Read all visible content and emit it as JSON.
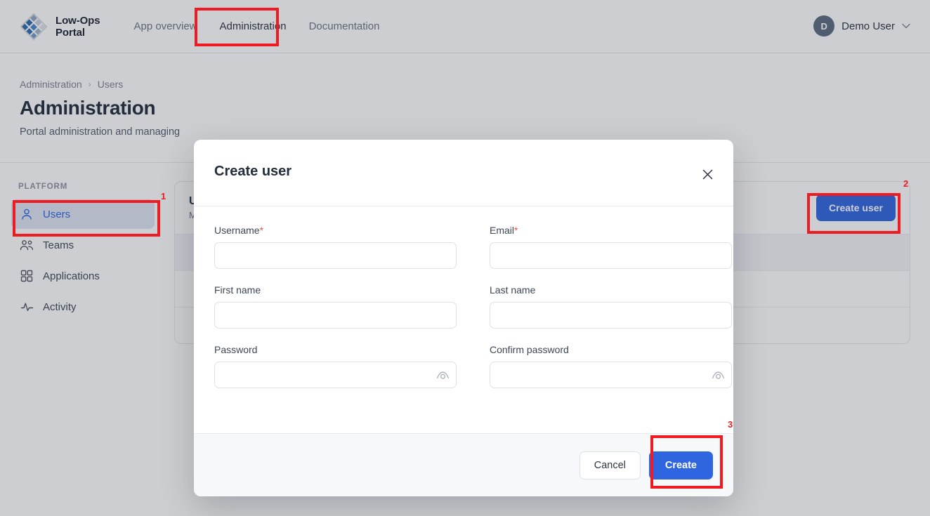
{
  "topbar": {
    "brand_line1": "Low-Ops",
    "brand_line2": "Portal",
    "nav": [
      {
        "label": "App overview",
        "active": false
      },
      {
        "label": "Administration",
        "active": true
      },
      {
        "label": "Documentation",
        "active": false
      }
    ],
    "user": {
      "initial": "D",
      "name": "Demo User",
      "chevron": "∨"
    }
  },
  "page_header": {
    "breadcrumb": {
      "root": "Administration",
      "separator": "›",
      "current": "Users"
    },
    "title": "Administration",
    "subtitle": "Portal administration and managing"
  },
  "sidebar": {
    "section_label": "PLATFORM",
    "items": [
      {
        "label": "Users",
        "icon": "user-icon",
        "active": true
      },
      {
        "label": "Teams",
        "icon": "users-group-icon",
        "active": false
      },
      {
        "label": "Applications",
        "icon": "grid-icon",
        "active": false
      },
      {
        "label": "Activity",
        "icon": "activity-pulse-icon",
        "active": false
      }
    ]
  },
  "content_card": {
    "title": "Users",
    "subtitle": "Manage portal users",
    "create_button": "Create user",
    "rows": [
      "",
      "",
      "",
      ""
    ]
  },
  "modal": {
    "title": "Create user",
    "close_icon": "×",
    "fields": [
      {
        "label": "Username",
        "required": true,
        "value": "",
        "placeholder": "",
        "type": "text"
      },
      {
        "label": "Email",
        "required": true,
        "value": "",
        "placeholder": "",
        "type": "text"
      },
      {
        "label": "First name",
        "required": false,
        "value": "",
        "placeholder": "",
        "type": "text"
      },
      {
        "label": "Last name",
        "required": false,
        "value": "",
        "placeholder": "",
        "type": "text"
      },
      {
        "label": "Password",
        "required": false,
        "value": "",
        "placeholder": "",
        "type": "password"
      },
      {
        "label": "Confirm password",
        "required": false,
        "value": "",
        "placeholder": "",
        "type": "password"
      }
    ],
    "required_marker": "*",
    "cancel_label": "Cancel",
    "create_label": "Create"
  },
  "annotations": [
    {
      "number": "1",
      "target": "sidebar-item-users"
    },
    {
      "number": "2",
      "target": "create-user-button"
    },
    {
      "number": "3",
      "target": "modal-create-button"
    }
  ],
  "colors": {
    "accent_blue": "#2f66e0",
    "annotation_red": "#ee1c22",
    "required_red": "#e05b4b",
    "avatar_bg": "#5b6b80"
  }
}
